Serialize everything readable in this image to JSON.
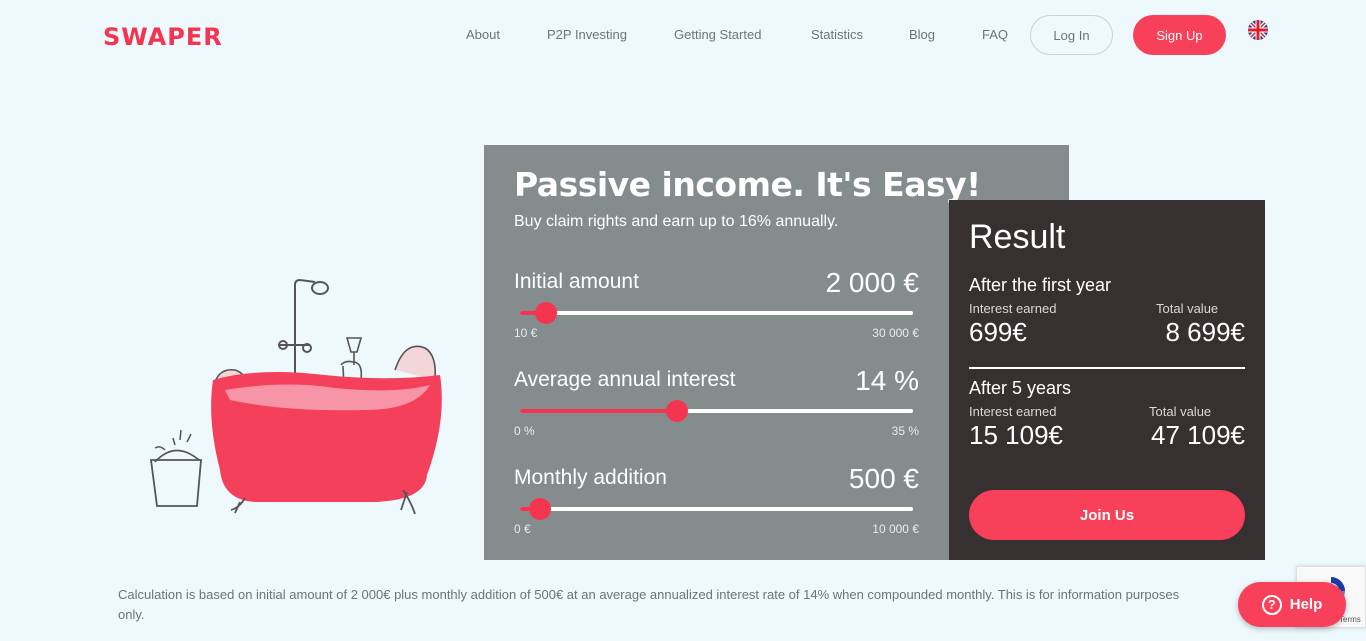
{
  "header": {
    "logo_text": "SWAPER",
    "nav": [
      "About",
      "P2P Investing",
      "Getting Started",
      "Statistics",
      "Blog",
      "FAQ"
    ],
    "login_label": "Log In",
    "signup_label": "Sign Up",
    "language_icon": "uk-flag-icon"
  },
  "calculator": {
    "title": "Passive income. It's Easy!",
    "subtitle": "Buy claim rights and earn up to 16% annually.",
    "sliders": [
      {
        "label": "Initial amount",
        "value": "2 000 €",
        "min_label": "10 €",
        "max_label": "30 000 €",
        "fraction": 0.066
      },
      {
        "label": "Average annual interest",
        "value": "14 %",
        "min_label": "0 %",
        "max_label": "35 %",
        "fraction": 0.4
      },
      {
        "label": "Monthly addition",
        "value": "500 €",
        "min_label": "0 €",
        "max_label": "10 000 €",
        "fraction": 0.05
      }
    ]
  },
  "result": {
    "title": "Result",
    "periods": [
      {
        "title": "After the first year",
        "interest_label": "Interest earned",
        "interest_value": "699€",
        "total_label": "Total value",
        "total_value": "8 699€"
      },
      {
        "title": "After 5 years",
        "interest_label": "Interest earned",
        "interest_value": "15 109€",
        "total_label": "Total value",
        "total_value": "47 109€"
      }
    ],
    "join_label": "Join Us"
  },
  "disclaimer": "Calculation is based on initial amount of 2 000€ plus monthly addition of 500€ at an average annualized interest rate of 14% when compounded monthly. This is for information purposes only.",
  "help_label": "Help",
  "recaptcha_text": "Terms",
  "colors": {
    "brand": "#f5344f",
    "panel": "#858c8e",
    "result_panel": "#363030",
    "background": "#eef9fd"
  }
}
